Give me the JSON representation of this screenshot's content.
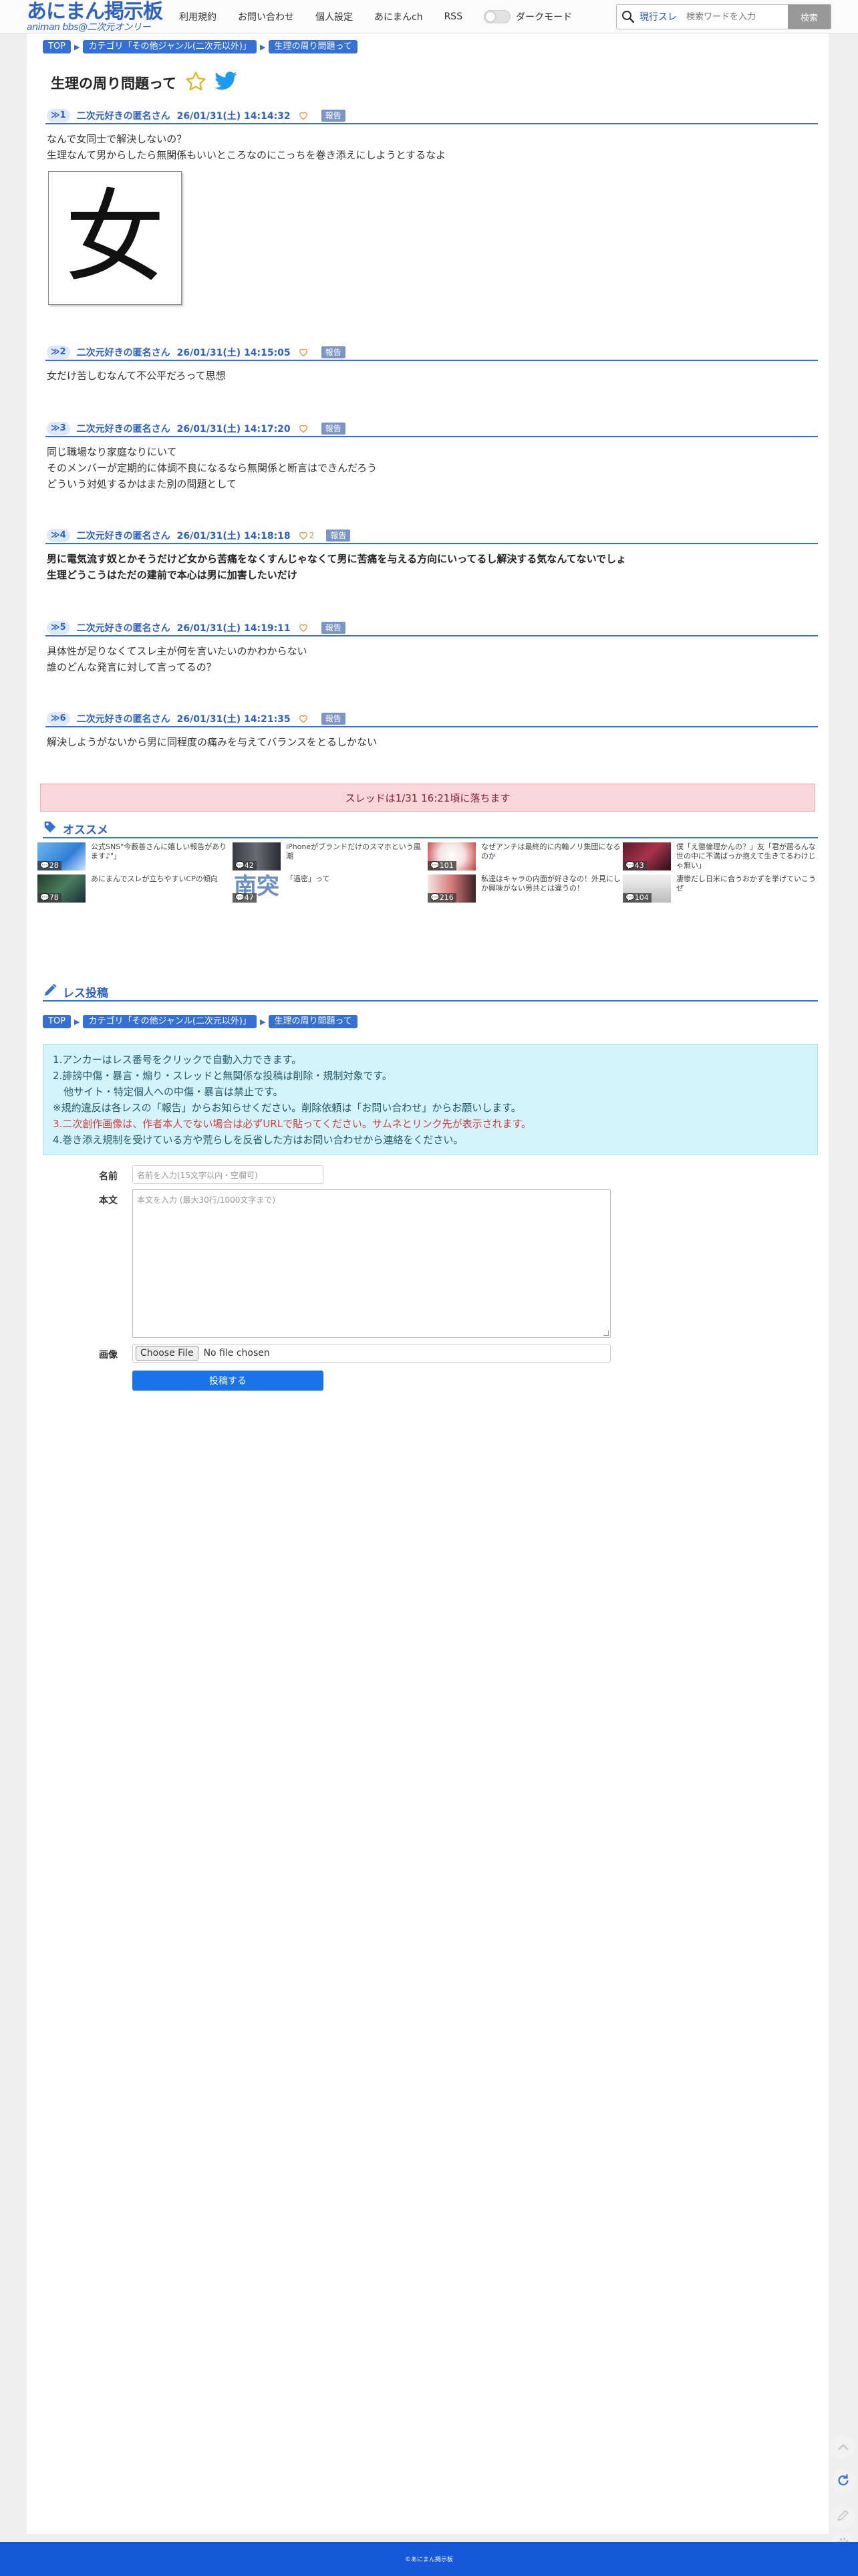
{
  "header": {
    "logo_main": "あにまん掲示板",
    "logo_sub": "animan bbs@二次元オンリー",
    "nav": [
      "利用規約",
      "お問い合わせ",
      "個人設定",
      "あにまんch",
      "RSS"
    ],
    "dark_mode_label": "ダークモード",
    "search_scope": "現行スレ",
    "search_placeholder": "検索ワードを入力",
    "search_button": "検索"
  },
  "breadcrumb": [
    "TOP",
    "カテゴリ「その他ジャンル(二次元以外)」",
    "生理の周り問題って"
  ],
  "thread": {
    "title": "生理の周り問題って"
  },
  "posts": [
    {
      "num": "1",
      "name": "二次元好きの匿名さん",
      "date": "26/01/31(土) 14:14:32",
      "likes": "",
      "report": "報告",
      "lines": [
        "なんで女同士で解決しないの？",
        "生理なんて男からしたら無関係もいいところなのにこっちを巻き添えにしようとするなよ"
      ],
      "image_char": "女"
    },
    {
      "num": "2",
      "name": "二次元好きの匿名さん",
      "date": "26/01/31(土) 14:15:05",
      "likes": "",
      "report": "報告",
      "lines": [
        "女だけ苦しむなんて不公平だろって思想"
      ]
    },
    {
      "num": "3",
      "name": "二次元好きの匿名さん",
      "date": "26/01/31(土) 14:17:20",
      "likes": "",
      "report": "報告",
      "lines": [
        "同じ職場なり家庭なりにいて",
        "そのメンバーが定期的に体調不良になるなら無関係と断言はできんだろう",
        "どういう対処するかはまた別の問題として"
      ]
    },
    {
      "num": "4",
      "name": "二次元好きの匿名さん",
      "date": "26/01/31(土) 14:18:18",
      "likes": "2",
      "report": "報告",
      "bold": true,
      "lines": [
        "男に電気流す奴とかそうだけど女から苦痛をなくすんじゃなくて男に苦痛を与える方向にいってるし解決する気なんてないでしょ",
        "生理どうこうはただの建前で本心は男に加害したいだけ"
      ]
    },
    {
      "num": "5",
      "name": "二次元好きの匿名さん",
      "date": "26/01/31(土) 14:19:11",
      "likes": "",
      "report": "報告",
      "lines": [
        "具体性が足りなくてスレ主が何を言いたいのかわからない",
        "誰のどんな発言に対して言ってるの？"
      ]
    },
    {
      "num": "6",
      "name": "二次元好きの匿名さん",
      "date": "26/01/31(土) 14:21:35",
      "likes": "",
      "report": "報告",
      "lines": [
        "解決しようがないから男に同程度の痛みを与えてバランスをとるしかない"
      ]
    }
  ],
  "fall_notice": "スレッドは1/31 16:21頃に落ちます",
  "recommend": {
    "heading": "オススメ",
    "items": [
      {
        "title": "公式SNS\"今薮善さんに嬉しい報告があります♪\"」",
        "count": "28"
      },
      {
        "title": "iPhoneがブランドだけのスマホという風潮",
        "count": "42"
      },
      {
        "title": "なぜアンチは最終的に内輪ノリ集団になるのか",
        "count": "101"
      },
      {
        "title": "僕「え懲倫理かんの？」友「君が居るんな世の中に不満ばっか抱えて生きてるわけじゃ無い」",
        "count": "43"
      },
      {
        "title": "あにまんでスレが立ちやすいCPの傾向",
        "count": "78"
      },
      {
        "title": "「過密」って",
        "count": "47"
      },
      {
        "title": "私達はキャラの内面が好きなの！外見にしか興味がない男共とは違うの！",
        "count": "216"
      },
      {
        "title": "凄惨だし日米に合うおかずを挙げていこうぜ",
        "count": "104"
      }
    ]
  },
  "reply": {
    "heading": "レス投稿",
    "rules": [
      "1.アンカーはレス番号をクリックで自動入力できます。",
      "2.誹謗中傷・暴言・煽り・スレッドと無関係な投稿は削除・規制対象です。",
      "他サイト・特定個人への中傷・暴言は禁止です。",
      "※規約違反は各レスの「報告」からお知らせください。削除依頼は「お問い合わせ」からお願いします。",
      "3.二次創作画像は、作者本人でない場合は必ずURLで貼ってください。サムネとリンク先が表示されます。",
      "4.巻き添え規制を受けている方や荒らしを反省した方はお問い合わせから連絡をください。"
    ],
    "name_label": "名前",
    "name_placeholder": "名前を入力(15文字以内・空欄可)",
    "body_label": "本文",
    "body_placeholder": "本文を入力 (最大30行/1000文字まで)",
    "image_label": "画像",
    "file_button": "Choose File",
    "file_status": "No file chosen",
    "submit": "投稿する"
  },
  "footer": "©あにまん掲示板",
  "colors": {
    "accent": "#3470d6",
    "submit": "#1a73e8",
    "footer": "#1658d8",
    "notice_bg": "#f8d7da",
    "rules_bg": "#d2f4fa"
  }
}
